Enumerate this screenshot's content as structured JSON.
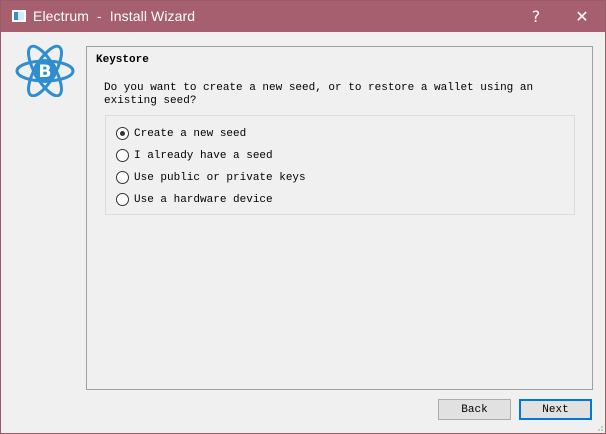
{
  "window": {
    "title": "Electrum  -  Install Wizard",
    "help_symbol": "?",
    "close_symbol": "✕",
    "title_bar_color": "#a55f6f",
    "accent_color": "#0078d7"
  },
  "logo": {
    "icon": "electrum-bitcoin-atom-logo",
    "symbol": "B",
    "color": "#2f8ecf"
  },
  "keystore": {
    "heading": "Keystore",
    "question": "Do you want to create a new seed, or to restore a wallet using an existing seed?",
    "options": [
      {
        "label": "Create a new seed",
        "selected": true
      },
      {
        "label": "I already have a seed",
        "selected": false
      },
      {
        "label": "Use public or private keys",
        "selected": false
      },
      {
        "label": "Use a hardware device",
        "selected": false
      }
    ]
  },
  "buttons": {
    "back": "Back",
    "next": "Next"
  }
}
